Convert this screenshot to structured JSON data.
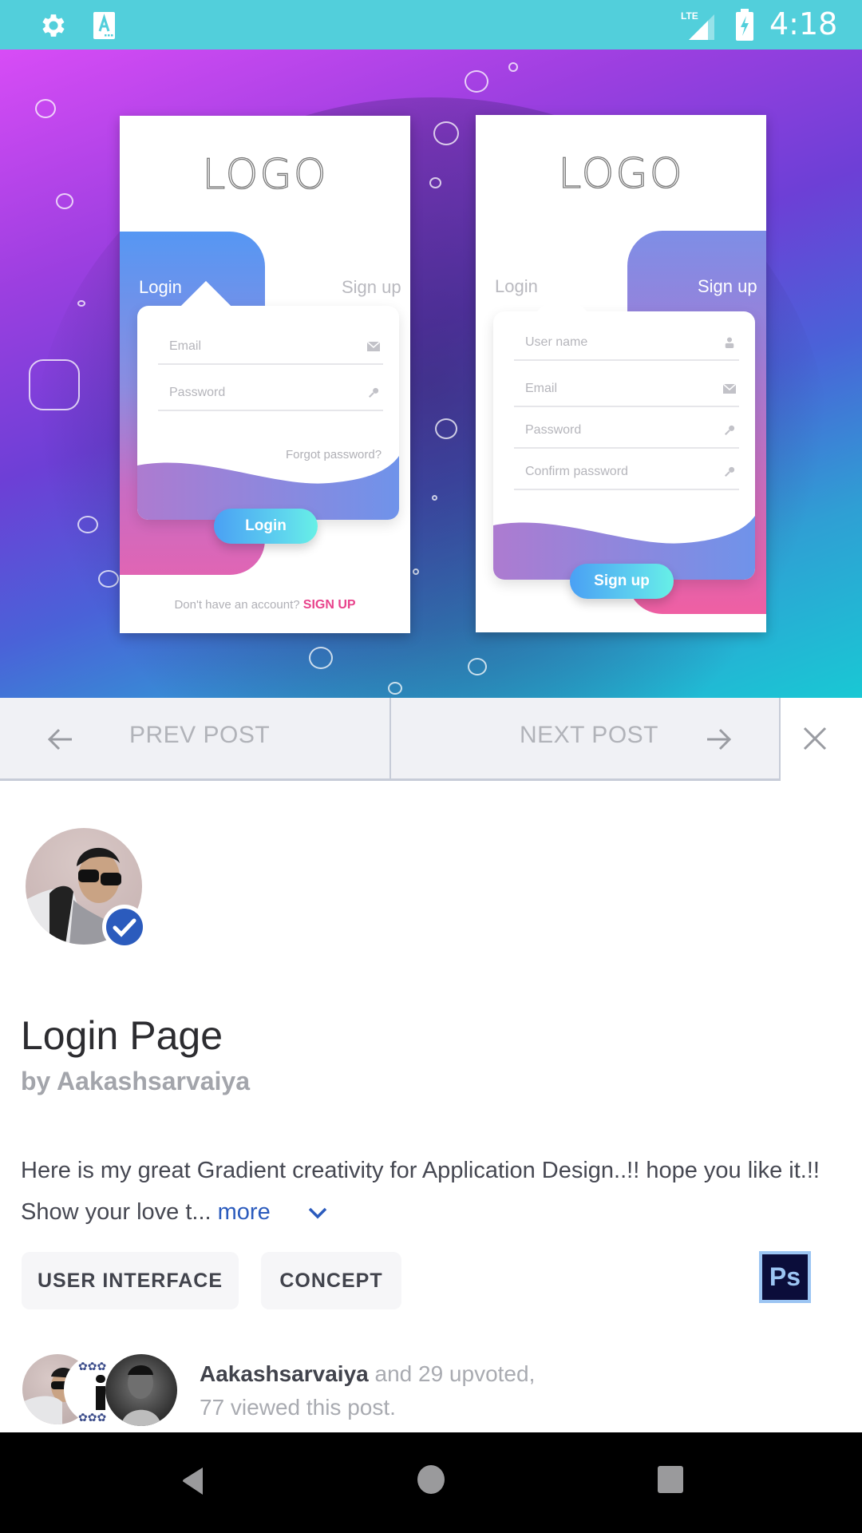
{
  "status_bar": {
    "time": "4:18",
    "network": "LTE",
    "left_icons": [
      "gear-icon",
      "a-keyboard-icon"
    ],
    "right_icons": [
      "lte-signal-icon",
      "battery-charging-icon"
    ],
    "background": "#52cfdb"
  },
  "hero": {
    "description": "Login / Sign up gradient UI mockups",
    "mock_left": {
      "logo": "LOGO",
      "tab_login": "Login",
      "tab_signup": "Sign up",
      "fields": [
        {
          "placeholder": "Email",
          "icon": "envelope-icon"
        },
        {
          "placeholder": "Password",
          "icon": "key-icon"
        }
      ],
      "forgot": "Forgot password?",
      "button": "Login",
      "no_account": "Don't have an account?",
      "sign_up_link": "SIGN UP"
    },
    "mock_right": {
      "logo": "LOGO",
      "tab_login": "Login",
      "tab_signup": "Sign up",
      "fields": [
        {
          "placeholder": "User name",
          "icon": "user-icon"
        },
        {
          "placeholder": "Email",
          "icon": "envelope-icon"
        },
        {
          "placeholder": "Password",
          "icon": "key-icon"
        },
        {
          "placeholder": "Confirm password",
          "icon": "key-icon"
        }
      ],
      "button": "Sign up"
    }
  },
  "post_nav": {
    "prev_label": "PREV POST",
    "next_label": "NEXT POST"
  },
  "post": {
    "title": "Login Page",
    "byline": "by Aakashsarvaiya",
    "description": "Here is my great Gradient creativity for Application Design..!! hope you like it.!! Show your love t...",
    "more_label": "more",
    "tags": [
      "USER INTERFACE",
      "CONCEPT"
    ],
    "tool": "Ps",
    "upvote": {
      "user": "Aakashsarvaiya",
      "upvote_text": " and 29 upvoted,",
      "views_text": "77 viewed this post."
    }
  },
  "colors": {
    "accent": "#2b5bbd",
    "pink": "#e8438c",
    "ps_bg": "#0b0d3a",
    "ps_fg": "#9cc5f3"
  }
}
